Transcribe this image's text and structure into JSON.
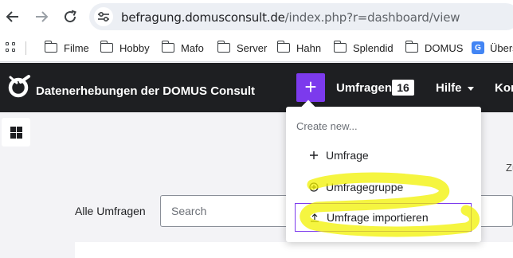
{
  "browser": {
    "url_domain": "befragung.domusconsult.de",
    "url_path": "/index.php?r=dashboard/view"
  },
  "bookmarks": [
    {
      "label": "Filme",
      "icon": "folder-icon"
    },
    {
      "label": "Hobby",
      "icon": "folder-icon"
    },
    {
      "label": "Mafo",
      "icon": "folder-icon"
    },
    {
      "label": "Server",
      "icon": "folder-icon"
    },
    {
      "label": "Hahn",
      "icon": "folder-icon"
    },
    {
      "label": "Splendid",
      "icon": "folder-icon"
    },
    {
      "label": "DOMUS",
      "icon": "folder-icon"
    },
    {
      "label": "Übers",
      "icon": "google-translate-icon"
    }
  ],
  "navbar": {
    "brand": "Datenerhebungen der DOMUS Consult",
    "plus_label": "+",
    "surveys_label": "Umfragen",
    "surveys_count": "16",
    "help_label": "Hilfe",
    "more_label": "Kon"
  },
  "dropdown": {
    "header": "Create new...",
    "items": [
      {
        "label": "Umfrage",
        "icon": "plus-icon"
      },
      {
        "label": "Umfragegruppe",
        "icon": "circle-plus-icon"
      },
      {
        "label": "Umfrage importieren",
        "icon": "upload-icon"
      }
    ]
  },
  "content": {
    "zu_text": "Zu",
    "all_surveys_label": "Alle Umfragen",
    "search_placeholder": "Search"
  },
  "colors": {
    "accent": "#7c3aed",
    "navbar_bg": "#1e1f22",
    "page_bg": "#f3f3f6",
    "highlight": "#f2f200"
  }
}
